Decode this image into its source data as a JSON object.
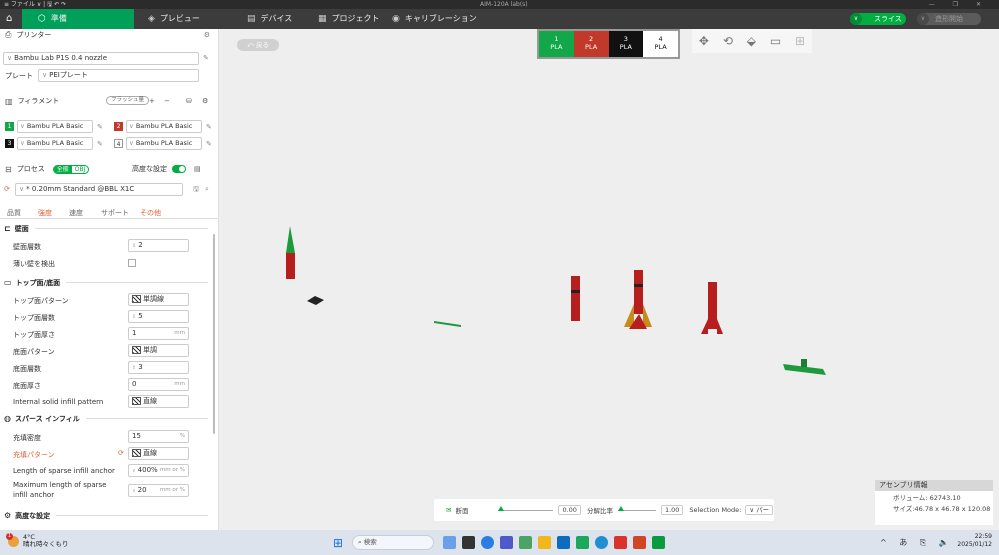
{
  "titlebar": {
    "menu": "≡ ファイル  ∨  |  🖫  ↶  ↷",
    "title": "AIM-120A lab(s)",
    "controls": "— ❐ ✕"
  },
  "toolbar": {
    "tabs": [
      {
        "label": "準備",
        "icon": "cube-icon"
      },
      {
        "label": "プレビュー",
        "icon": "layers-icon"
      },
      {
        "label": "デバイス",
        "icon": "device-icon"
      },
      {
        "label": "プロジェクト",
        "icon": "project-icon"
      },
      {
        "label": "キャリブレーション",
        "icon": "calibration-icon"
      }
    ],
    "slice_label": "スライス",
    "print_label": "造形開始"
  },
  "printer": {
    "section_title": "プリンター",
    "model": "Bambu Lab P1S 0.4 nozzle",
    "plate_label": "プレート",
    "plate_value": "PEIプレート"
  },
  "filament": {
    "section_title": "フィラメント",
    "flush_label": "フラッシュ量",
    "items": [
      {
        "num": "1",
        "name": "Bambu PLA Basic",
        "color": "#12a84a",
        "fg": "#ffffff"
      },
      {
        "num": "2",
        "name": "Bambu PLA Basic",
        "color": "#c0392b",
        "fg": "#ffffff"
      },
      {
        "num": "3",
        "name": "Bambu PLA Basic",
        "color": "#111111",
        "fg": "#ffffff"
      },
      {
        "num": "4",
        "name": "Bambu PLA Basic",
        "color": "#ffffff",
        "fg": "#333333"
      }
    ]
  },
  "process": {
    "section_title": "プロセス",
    "scope_all": "全般",
    "scope_obj": "OBJ",
    "advanced_label": "高度な設定",
    "preset": "* 0.20mm Standard @BBL X1C",
    "tabs": [
      "品質",
      "強度",
      "速度",
      "サポート",
      "その他"
    ],
    "groups": {
      "wall": "壁面",
      "topbottom": "トップ面/底面",
      "sparse": "スパース インフィル",
      "advanced": "高度な設定"
    },
    "params": {
      "wall_loops": {
        "label": "壁面層数",
        "value": "2"
      },
      "detect_thin": {
        "label": "薄い壁を検出"
      },
      "top_pattern": {
        "label": "トップ面パターン",
        "value": "単調線"
      },
      "top_layers": {
        "label": "トップ面層数",
        "value": "5"
      },
      "top_thick": {
        "label": "トップ面厚さ",
        "value": "1",
        "unit": "mm"
      },
      "bottom_pattern": {
        "label": "底面パターン",
        "value": "単調"
      },
      "bottom_layers": {
        "label": "底面層数",
        "value": "3"
      },
      "bottom_thick": {
        "label": "底面厚さ",
        "value": "0",
        "unit": "mm"
      },
      "internal_solid": {
        "label": "Internal solid infill pattern",
        "value": "直線"
      },
      "infill_density": {
        "label": "充填密度",
        "value": "15",
        "unit": "%"
      },
      "infill_pattern": {
        "label": "充填パターン",
        "value": "直線"
      },
      "anchor_len": {
        "label": "Length of sparse infill anchor",
        "value": "400%",
        "unit": "mm or %"
      },
      "anchor_max_1": {
        "label": "Maximum length of sparse",
        "label2": "infill anchor",
        "value": "20",
        "unit": "mm or %"
      }
    }
  },
  "viewport": {
    "back_label": "戻る",
    "slots": [
      {
        "num": "1",
        "mat": "PLA",
        "color": "#12a84a",
        "fg": "#ffffff"
      },
      {
        "num": "2",
        "mat": "PLA",
        "color": "#c0392b",
        "fg": "#ffffff"
      },
      {
        "num": "3",
        "mat": "PLA",
        "color": "#111111",
        "fg": "#ffffff"
      },
      {
        "num": "4",
        "mat": "PLA",
        "color": "#ffffff",
        "fg": "#111111"
      }
    ],
    "bottom_bar": {
      "section_label": "断面",
      "section_value": "0.00",
      "ratio_label": "分解比率",
      "ratio_value": "1.00",
      "mode_label": "Selection Mode:",
      "mode_value": "パー"
    },
    "assembly": {
      "title": "アセンブリ情報",
      "volume_label": "ボリューム:",
      "volume_value": "62743.10",
      "size_label": "サイズ:",
      "size_value": "46.78 x 46.78 x 120.08"
    }
  },
  "taskbar": {
    "weather_temp": "4°C",
    "weather_desc": "晴れ時々くもり",
    "search_placeholder": "検索",
    "tray_text": "^ あ ⎘ 🔈",
    "time": "22:59",
    "date": "2025/01/12"
  }
}
